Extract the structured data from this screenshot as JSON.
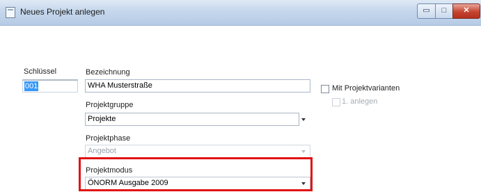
{
  "window": {
    "title": "Neues Projekt anlegen",
    "buttons": {
      "minimize": "▭",
      "maximize": "□",
      "close": "✕"
    }
  },
  "form": {
    "key": {
      "label": "Schlüssel",
      "value": "001"
    },
    "description": {
      "label": "Bezeichnung",
      "value": "WHA Musterstraße"
    },
    "project_group": {
      "label": "Projektgruppe",
      "value": "Projekte"
    },
    "project_phase": {
      "label": "Projektphase",
      "value": "Angebot"
    },
    "project_mode": {
      "label": "Projektmodus",
      "value": "ÖNORM Ausgabe 2009"
    },
    "variants": {
      "label": "Mit Projektvarianten",
      "sub_label": "1. anlegen"
    }
  },
  "colors": {
    "highlight": "#e11313",
    "selection": "#3399ff"
  }
}
